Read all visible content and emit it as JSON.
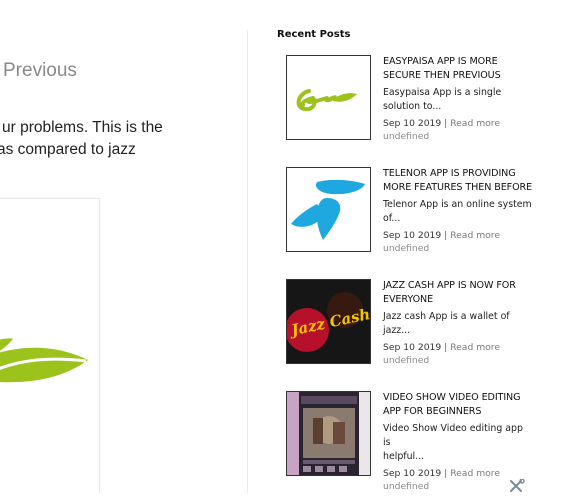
{
  "main": {
    "title_fragment": "Previous",
    "body_lines": [
      "ur problems. This is the",
      "as compared to jazz"
    ]
  },
  "sidebar": {
    "widget_title": "Recent Posts",
    "posts": [
      {
        "title_lines": [
          "EASYPAISA APP IS MORE",
          "SECURE THEN PREVIOUS"
        ],
        "excerpt_lines": [
          "Easypaisa App is a single",
          "solution to..."
        ],
        "date": "Sep 10 2019",
        "separator": "|",
        "read_more": "Read more",
        "author": "undefined",
        "thumb_icon": "easypaisa-logo-icon"
      },
      {
        "title_lines": [
          "TELENOR APP IS PROVIDING",
          "MORE FEATURES THEN BEFORε"
        ],
        "excerpt_lines": [
          "Telenor App is an online system",
          "of..."
        ],
        "date": "Sep 10 2019",
        "separator": "|",
        "read_more": "Read more",
        "author": "undefined",
        "thumb_icon": "telenor-logo-icon"
      },
      {
        "title_lines": [
          "JAZZ CASH APP IS NOW FOR",
          "EVERYONE"
        ],
        "excerpt_lines": [
          "Jazz cash App is a wallet of jazz..."
        ],
        "date": "Sep 10 2019",
        "separator": "|",
        "read_more": "Read more",
        "author": "undefined",
        "thumb_text": "Jazz Cash",
        "thumb_icon": "jazzcash-logo-icon"
      },
      {
        "title_lines": [
          "VIDEO SHOW VIDEO EDITING",
          "APP FOR BEGINNERS"
        ],
        "excerpt_lines": [
          "Video Show Video editing app is",
          "helpful..."
        ],
        "date": "Sep 10 2019",
        "separator": "|",
        "read_more": "Read more",
        "author": "undefined",
        "thumb_icon": "video-show-app-screenshot-icon"
      }
    ]
  },
  "colors": {
    "easypaisa_green": "#9bc31c",
    "telenor_blue": "#1fa8e0",
    "jazz_red": "#c8102e",
    "jazz_yellow": "#f5c400",
    "muted_text": "#8a8a8a"
  }
}
